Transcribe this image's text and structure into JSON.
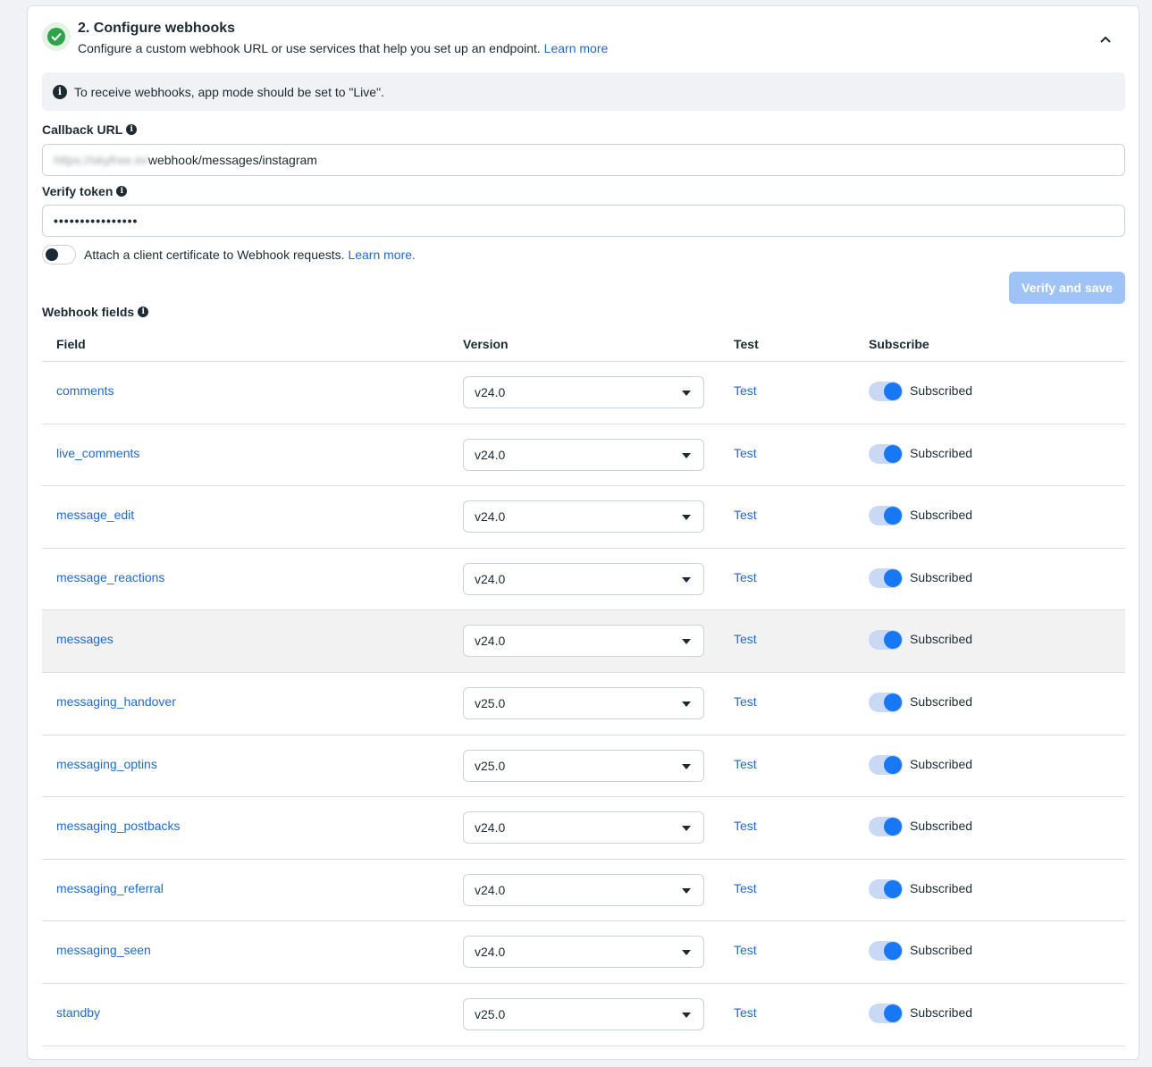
{
  "step": {
    "title": "2. Configure webhooks",
    "description": "Configure a custom webhook URL or use services that help you set up an endpoint.",
    "learn_more": "Learn more"
  },
  "banner": {
    "text": "To receive webhooks, app mode should be set to \"Live\"."
  },
  "callback": {
    "label": "Callback URL",
    "value_prefix": "https://skyfree.in/",
    "value_suffix": "webhook/messages/instagram"
  },
  "verify_token": {
    "label": "Verify token",
    "value": "••••••••••••••••"
  },
  "certificate": {
    "label": "Attach a client certificate to Webhook requests.",
    "learn_more": "Learn more."
  },
  "verify_button": "Verify and save",
  "webhook_fields": {
    "label": "Webhook fields",
    "columns": {
      "field": "Field",
      "version": "Version",
      "test": "Test",
      "subscribe": "Subscribe"
    },
    "rows": [
      {
        "field": "comments",
        "version": "v24.0",
        "test": "Test",
        "status": "Subscribed"
      },
      {
        "field": "live_comments",
        "version": "v24.0",
        "test": "Test",
        "status": "Subscribed"
      },
      {
        "field": "message_edit",
        "version": "v24.0",
        "test": "Test",
        "status": "Subscribed"
      },
      {
        "field": "message_reactions",
        "version": "v24.0",
        "test": "Test",
        "status": "Subscribed"
      },
      {
        "field": "messages",
        "version": "v24.0",
        "test": "Test",
        "status": "Subscribed"
      },
      {
        "field": "messaging_handover",
        "version": "v25.0",
        "test": "Test",
        "status": "Subscribed"
      },
      {
        "field": "messaging_optins",
        "version": "v25.0",
        "test": "Test",
        "status": "Subscribed"
      },
      {
        "field": "messaging_postbacks",
        "version": "v24.0",
        "test": "Test",
        "status": "Subscribed"
      },
      {
        "field": "messaging_referral",
        "version": "v24.0",
        "test": "Test",
        "status": "Subscribed"
      },
      {
        "field": "messaging_seen",
        "version": "v24.0",
        "test": "Test",
        "status": "Subscribed"
      },
      {
        "field": "standby",
        "version": "v25.0",
        "test": "Test",
        "status": "Subscribed"
      }
    ]
  }
}
